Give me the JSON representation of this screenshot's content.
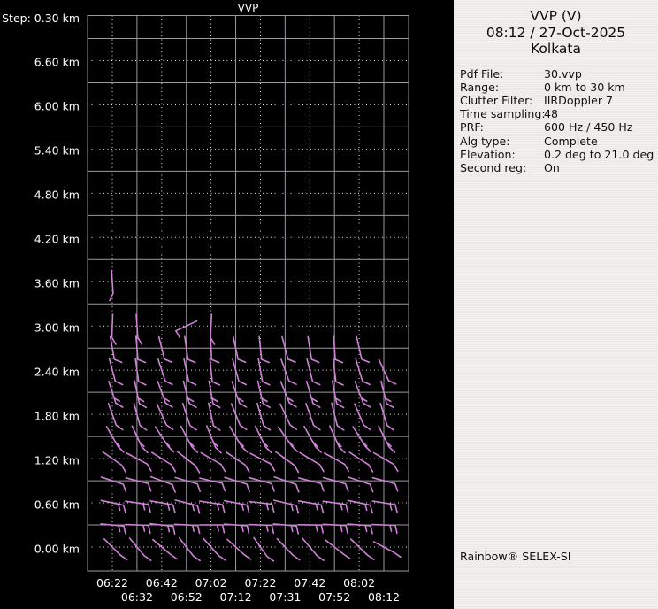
{
  "window": {
    "background": "#000000"
  },
  "plot": {
    "title": "VVP",
    "step_label": "Step: 0.30 km",
    "height_labels": [
      {
        "text": "6.60 km",
        "km": 6.6
      },
      {
        "text": "6.00 km",
        "km": 6.0
      },
      {
        "text": "5.40 km",
        "km": 5.4
      },
      {
        "text": "4.80 km",
        "km": 4.8
      },
      {
        "text": "4.20 km",
        "km": 4.2
      },
      {
        "text": "3.60 km",
        "km": 3.6
      },
      {
        "text": "3.00 km",
        "km": 3.0
      },
      {
        "text": "2.40 km",
        "km": 2.4
      },
      {
        "text": "1.80 km",
        "km": 1.8
      },
      {
        "text": "1.20 km",
        "km": 1.2
      },
      {
        "text": "0.60 km",
        "km": 0.6
      },
      {
        "text": "0.00 km",
        "km": 0.0
      }
    ],
    "time_labels": [
      {
        "text": "06:22",
        "t": 0
      },
      {
        "text": "06:32",
        "t": 1
      },
      {
        "text": "06:42",
        "t": 2
      },
      {
        "text": "06:52",
        "t": 3
      },
      {
        "text": "07:02",
        "t": 4
      },
      {
        "text": "07:12",
        "t": 5
      },
      {
        "text": "07:22",
        "t": 6
      },
      {
        "text": "07:31",
        "t": 7
      },
      {
        "text": "07:42",
        "t": 8
      },
      {
        "text": "07:52",
        "t": 9
      },
      {
        "text": "08:02",
        "t": 10
      },
      {
        "text": "08:12",
        "t": 11
      }
    ]
  },
  "chart_data": {
    "type": "scatter",
    "subtype": "wind-barb-time-height-profile",
    "title": "VVP",
    "xlabel": "",
    "ylabel": "",
    "x": [
      "06:22",
      "06:32",
      "06:42",
      "06:52",
      "07:02",
      "07:12",
      "07:22",
      "07:31",
      "07:42",
      "07:52",
      "08:02",
      "08:12"
    ],
    "y_ticks_km": [
      0.0,
      0.6,
      1.2,
      1.8,
      2.4,
      3.0,
      3.6,
      4.2,
      4.8,
      5.4,
      6.0,
      6.6
    ],
    "height_step_km": 0.3,
    "ylim_km": [
      -0.3,
      7.2
    ],
    "grid": "on",
    "barb_rows": [
      {
        "h": 0.0,
        "feather_dir": 125,
        "ticks": 1,
        "angles": [
          -45,
          -40,
          -50,
          -38,
          -42,
          -48,
          -35,
          -44,
          -40,
          -52,
          -46,
          -62
        ]
      },
      {
        "h": 0.3,
        "feather_dir": 168,
        "ticks": 2,
        "angles": [
          -85,
          -88,
          -84,
          -87,
          -90,
          -86,
          -88,
          -85,
          -89,
          -87,
          -86,
          -88
        ]
      },
      {
        "h": 0.6,
        "feather_dir": 165,
        "ticks": 2,
        "angles": [
          -78,
          -82,
          -80,
          -76,
          -81,
          -79,
          -83,
          -77,
          -80,
          -82,
          -78,
          -81
        ]
      },
      {
        "h": 0.9,
        "feather_dir": 160,
        "ticks": 1,
        "angles": [
          -72,
          -76,
          -70,
          -74,
          -77,
          -73,
          -75,
          -71,
          -76,
          -74,
          -72,
          -75
        ]
      },
      {
        "h": 1.2,
        "feather_dir": 150,
        "ticks": 1,
        "angles": [
          -55,
          -62,
          -58,
          -52,
          -60,
          -56,
          -63,
          -54,
          -59,
          -61,
          -57,
          -60
        ]
      },
      {
        "h": 1.5,
        "feather_dir": 135,
        "ticks": 2,
        "angles": [
          -30,
          -25,
          -33,
          -28,
          -22,
          -31,
          -26,
          -35,
          -29,
          -24,
          -32,
          -27
        ]
      },
      {
        "h": 1.8,
        "feather_dir": 125,
        "ticks": 1,
        "angles": [
          -20,
          -15,
          -24,
          -18,
          -12,
          -22,
          -16,
          -25,
          -19,
          -14,
          -23,
          -17
        ]
      },
      {
        "h": 2.1,
        "feather_dir": 120,
        "ticks": 2,
        "angles": [
          -18,
          -12,
          -20,
          -15,
          -10,
          -19,
          -13,
          -22,
          -16,
          -11,
          -21,
          -14
        ]
      },
      {
        "h": 2.4,
        "feather_dir": 115,
        "ticks": 1,
        "angles": [
          -15,
          -8,
          -18,
          -12,
          -6,
          -16,
          -10,
          -20,
          -14,
          -7,
          -17,
          -25
        ]
      },
      {
        "h": 2.7,
        "feather_dir": 112,
        "ticks": 1,
        "angles": [
          -10,
          -5,
          -14,
          -8,
          -3,
          -12,
          -6,
          -15,
          -9,
          -4,
          -13,
          null
        ]
      },
      {
        "h": 3.0,
        "feather_dir": 150,
        "ticks": 1,
        "angles": [
          2,
          -4,
          null,
          65,
          3,
          null,
          null,
          null,
          null,
          null,
          null,
          null
        ]
      },
      {
        "h": 3.6,
        "feather_dir": 205,
        "ticks": 1,
        "angles": [
          -4,
          null,
          null,
          null,
          null,
          null,
          null,
          null,
          null,
          null,
          null,
          null
        ]
      }
    ]
  },
  "panel": {
    "title": "VVP (V)",
    "datetime": "08:12 / 27-Oct-2025",
    "site": "Kolkata",
    "params": [
      {
        "label": "Pdf File:",
        "value": "30.vvp"
      },
      {
        "label": "Range:",
        "value": "0 km to 30 km"
      },
      {
        "label": "Clutter Filter:",
        "value": "IIRDoppler 7"
      },
      {
        "label": "Time sampling:",
        "value": "48"
      },
      {
        "label": "PRF:",
        "value": "600 Hz / 450 Hz"
      },
      {
        "label": "Alg type:",
        "value": "Complete"
      },
      {
        "label": "Elevation:",
        "value": "0.2 deg to 21.0 deg"
      },
      {
        "label": "Second reg:",
        "value": "On"
      }
    ],
    "branding": "Rainbow® SELEX-SI"
  },
  "colors": {
    "barb": "#cf82d6",
    "grid_solid": "#9a9aa2",
    "grid_dotted": "#e8e8e8",
    "plot_bg": "#000000",
    "panel_bg": "#f1f0ed",
    "text_light": "#ffffff",
    "text_dark": "#111111"
  }
}
